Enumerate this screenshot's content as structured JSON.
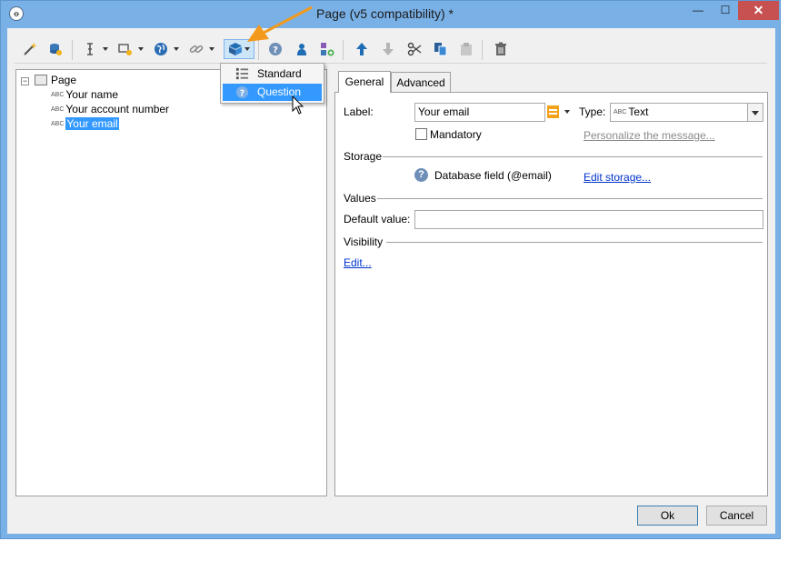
{
  "window": {
    "title": "Page (v5 compatibility) *",
    "app_icon_glyph": "ꝋ",
    "minimize_glyph": "—",
    "maximize_glyph": "☐",
    "close_glyph": "✕"
  },
  "toolbar": {
    "icons": [
      "wand-icon",
      "database-refresh-icon",
      "text-cursor-icon",
      "input-field-icon",
      "globe-icon",
      "link-icon",
      "cube-icon",
      "help-icon",
      "person-icon",
      "add-group-icon",
      "arrow-up-icon",
      "arrow-down-icon",
      "cut-icon",
      "copy-icon",
      "paste-icon",
      "delete-icon"
    ]
  },
  "dropdown_menu": {
    "items": [
      {
        "label": "Standard",
        "icon": "list-icon"
      },
      {
        "label": "Question",
        "icon": "question-icon"
      }
    ]
  },
  "tree": {
    "root": {
      "label": "Page",
      "expander": "⊟"
    },
    "abc_tag": "ABC",
    "children": [
      {
        "label": "Your name"
      },
      {
        "label": "Your account number"
      },
      {
        "label": "Your email"
      }
    ]
  },
  "tabs": [
    {
      "label": "General"
    },
    {
      "label": "Advanced"
    }
  ],
  "general": {
    "label_caption": "Label:",
    "label_value": "Your email",
    "type_caption": "Type:",
    "type_tag": "ABC",
    "type_value": "Text",
    "mandatory_label": "Mandatory",
    "personalize_link": "Personalize the message...",
    "storage_section": "Storage",
    "database_field": "Database field (@email)",
    "edit_storage_link": "Edit storage...",
    "values_section": "Values",
    "default_value_caption": "Default value:",
    "default_value": "",
    "visibility_section": "Visibility",
    "edit_link": "Edit..."
  },
  "footer": {
    "ok_label": "Ok",
    "cancel_label": "Cancel"
  },
  "colors": {
    "window_frame": "#79b0e6",
    "close_button": "#c75050",
    "selection": "#3399ff",
    "annotation_arrow": "#f39a1e",
    "link": "#0033cc"
  }
}
